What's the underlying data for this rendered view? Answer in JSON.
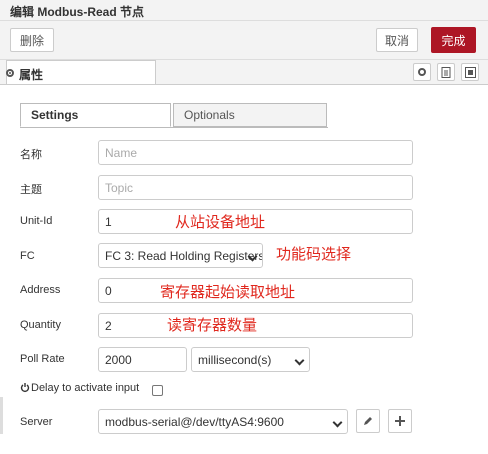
{
  "window": {
    "title": "编辑 Modbus-Read 节点"
  },
  "toolbar": {
    "delete_label": "删除",
    "cancel_label": "取消",
    "done_label": "完成"
  },
  "tabs": {
    "properties_label": "属性"
  },
  "subtabs": {
    "settings": "Settings",
    "optionals": "Optionals"
  },
  "form": {
    "name": {
      "label": "名称",
      "placeholder": "Name",
      "value": ""
    },
    "topic": {
      "label": "主题",
      "placeholder": "Topic",
      "value": ""
    },
    "unit_id": {
      "label": "Unit-Id",
      "value": "1"
    },
    "fc": {
      "label": "FC",
      "value": "FC 3: Read Holding Registers"
    },
    "address": {
      "label": "Address",
      "value": "0"
    },
    "quantity": {
      "label": "Quantity",
      "value": "2"
    },
    "poll_rate": {
      "label": "Poll Rate",
      "value": "2000",
      "unit": "millisecond(s)"
    },
    "delay": {
      "label": "Delay to activate input",
      "checked": false
    },
    "server": {
      "label": "Server",
      "value": "modbus-serial@/dev/ttyAS4:9600"
    }
  },
  "annotations": {
    "unit_id": "从站设备地址",
    "fc": "功能码选择",
    "address": "寄存器起始读取地址",
    "quantity": "读寄存器数量"
  },
  "icons": {
    "gear": "gear-icon",
    "description": "description-icon",
    "appearance": "appearance-icon",
    "power": "power-icon",
    "pencil": "pencil-icon",
    "plus": "plus-icon"
  },
  "colors": {
    "primary": "#ad1625",
    "annotation": "#e0281e"
  }
}
